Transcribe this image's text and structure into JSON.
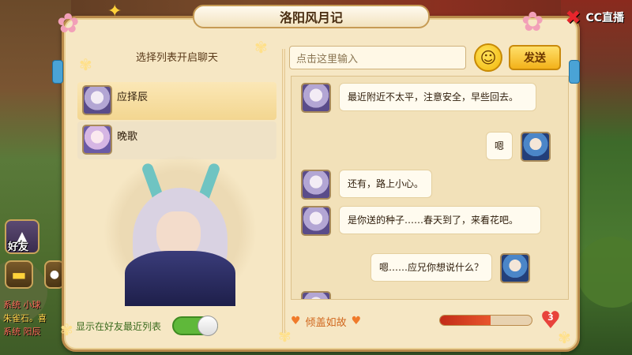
{
  "window": {
    "title": "洛阳风月记"
  },
  "left_panel": {
    "header": "选择列表开启聊天",
    "friends": [
      {
        "name": "应择辰",
        "selected": true
      },
      {
        "name": "晚歌",
        "selected": false
      }
    ],
    "show_recent_label": "显示在好友最近列表",
    "show_recent_enabled": true
  },
  "chat_input": {
    "placeholder": "点击这里输入",
    "send_label": "发送",
    "emoji_icon": "smiley-icon"
  },
  "messages": [
    {
      "from": "other",
      "text": "最近附近不太平，注意安全，早些回去。"
    },
    {
      "from": "me",
      "text": "嗯"
    },
    {
      "from": "other",
      "text": "还有，路上小心。"
    },
    {
      "from": "other",
      "text": "是你送的种子……春天到了，来看花吧。"
    },
    {
      "from": "me",
      "text": "嗯……应兄你想说什么？"
    }
  ],
  "intimacy": {
    "label": "倾盖如故",
    "level": "3",
    "progress": 0.55
  },
  "hud": {
    "friend_label": "好友",
    "chat_lines": [
      "系统 小球",
      "朱雀石。喜",
      "系统 阳辰"
    ]
  },
  "watermark": {
    "text": "CC直播"
  },
  "colors": {
    "accent": "#f3b21a",
    "panel": "#f6e7c4",
    "status": "#d0661c",
    "toggle_on": "#5fb83a"
  }
}
